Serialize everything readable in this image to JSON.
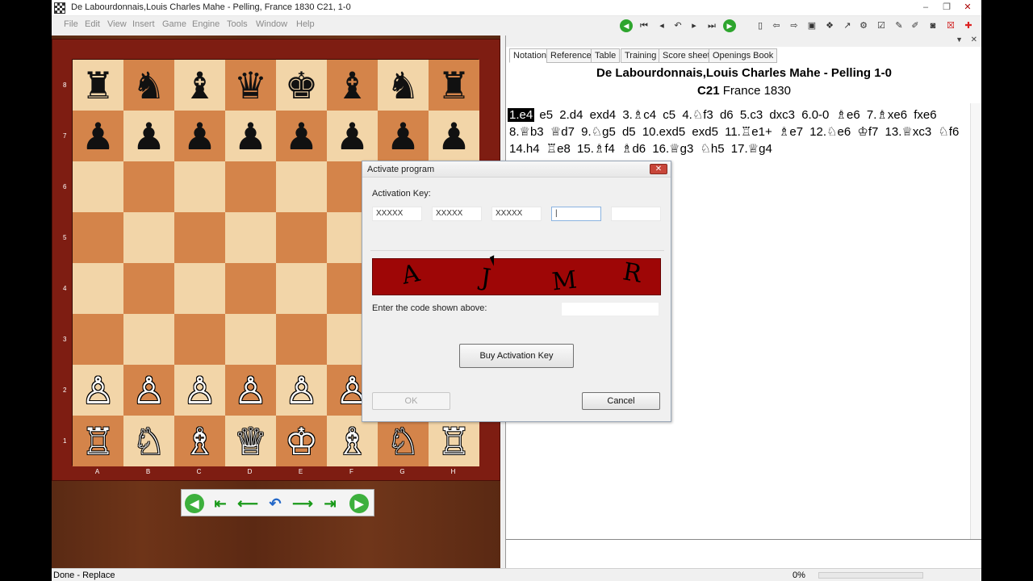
{
  "window": {
    "title": "De Labourdonnais,Louis Charles Mahe - Pelling, France 1830  C21, 1-0",
    "buttons": [
      "–",
      "❐",
      "✕"
    ]
  },
  "menu": [
    "File",
    "Edit",
    "View",
    "Insert",
    "Game",
    "Engine",
    "Tools",
    "Window",
    "Help"
  ],
  "tabs": [
    "Notation",
    "Reference",
    "Table",
    "Training",
    "Score sheet",
    "Openings Book"
  ],
  "game": {
    "heading": "De Labourdonnais,Louis Charles Mahe - Pelling  1-0",
    "eco": "C21",
    "event": "France 1830"
  },
  "moves": [
    "1.e4",
    "e5",
    "2.d4",
    "exd4",
    "3.♗c4",
    "c5",
    "4.♘f3",
    "d6",
    "5.c3",
    "dxc3",
    "6.0-0",
    "♗e6",
    "7.♗xe6",
    "fxe6",
    "8.♕b3",
    "♕d7",
    "9.♘g5",
    "d5",
    "10.exd5",
    "exd5",
    "11.♖e1+",
    "♗e7",
    "12.♘e6",
    "♔f7",
    "13.♕xc3",
    "♘f6",
    "14.h4",
    "♖e8",
    "15.♗f4",
    "♗d6",
    "16.♕g3",
    "♘h5",
    "17.♕g4"
  ],
  "board": {
    "ranks": [
      "8",
      "7",
      "6",
      "5",
      "4",
      "3",
      "2",
      "1"
    ],
    "files": [
      "A",
      "B",
      "C",
      "D",
      "E",
      "F",
      "G",
      "H"
    ],
    "pieces": {
      "8": [
        "♜",
        "♞",
        "♝",
        "♛",
        "♚",
        "♝",
        "♞",
        "♜"
      ],
      "7": [
        "♟",
        "♟",
        "♟",
        "♟",
        "♟",
        "♟",
        "♟",
        "♟"
      ],
      "2": [
        "♙",
        "♙",
        "♙",
        "♙",
        "♙",
        "♙",
        "♙",
        "♙"
      ],
      "1": [
        "♖",
        "♘",
        "♗",
        "♕",
        "♔",
        "♗",
        "♘",
        "♖"
      ]
    }
  },
  "dialog": {
    "title": "Activate program",
    "close": "✕",
    "key_label": "Activation Key:",
    "key_fields": [
      "XXXXX",
      "XXXXX",
      "XXXXX",
      "|",
      ""
    ],
    "captcha": [
      "A",
      "J",
      "M",
      "R"
    ],
    "code_label": "Enter the code shown above:",
    "buy_button": "Buy Activation Key",
    "ok_button": "OK",
    "cancel_button": "Cancel"
  },
  "status": {
    "text": "Done - Replace",
    "progress": "0%"
  },
  "colors": {
    "light_square": "#f2d5a8",
    "dark_square": "#d4844a",
    "captcha_bg": "#9e0606"
  }
}
